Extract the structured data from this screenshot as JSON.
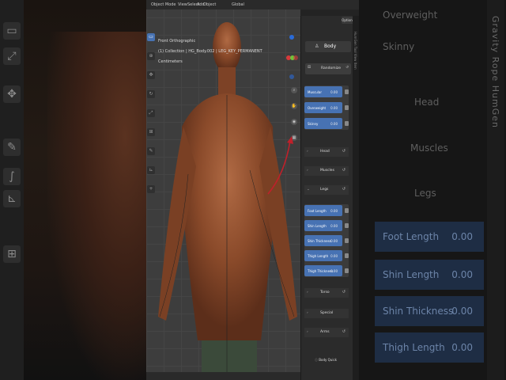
{
  "topbar": {
    "mode": "Object Mode",
    "menu": [
      "View",
      "Select",
      "Add",
      "Object"
    ],
    "transform": "Global",
    "options_label": "Options"
  },
  "viewport_info": {
    "view": "Front Orthographic",
    "collection": "(1) Collection | HG_Body.002 | LEG_KEY_PERMANENT",
    "units": "Centimeters"
  },
  "panel": {
    "title": "Body",
    "randomize_label": "Randomize",
    "top_sliders": [
      {
        "label": "Muscular",
        "value": "0.00"
      },
      {
        "label": "Overweight",
        "value": "0.00"
      },
      {
        "label": "Skinny",
        "value": "0.00"
      }
    ],
    "sections": [
      {
        "label": "Head",
        "expanded": false
      },
      {
        "label": "Muscles",
        "expanded": false
      },
      {
        "label": "Legs",
        "expanded": true
      }
    ],
    "leg_sliders": [
      {
        "label": "Foot Length",
        "value": "0.00"
      },
      {
        "label": "Shin Length",
        "value": "0.00"
      },
      {
        "label": "Shin Thickness",
        "value": "0.00"
      },
      {
        "label": "Thigh Length",
        "value": "0.00"
      },
      {
        "label": "Thigh Thickness",
        "value": "0.00"
      }
    ],
    "lower_sections": [
      {
        "label": "Torso",
        "expanded": false
      },
      {
        "label": "Special",
        "expanded": false
      },
      {
        "label": "Arms",
        "expanded": false
      }
    ],
    "footer": "Body Quick"
  },
  "side_tab_text": "HumGen  Tool  View  Item",
  "bg_right": {
    "tab_text": "Gravity Rope    HumGen",
    "top_rows": [
      {
        "label": "Overweight"
      },
      {
        "label": "Skinny"
      }
    ],
    "sections": [
      "Head",
      "Muscles",
      "Legs"
    ],
    "rows": [
      {
        "label": "Foot Length",
        "value": "0.00"
      },
      {
        "label": "Shin Length",
        "value": "0.00"
      },
      {
        "label": "Shin Thickness",
        "value": "0.00"
      },
      {
        "label": "Thigh Length",
        "value": "0.00"
      }
    ]
  },
  "colors": {
    "accent": "#4772b3",
    "panel_bg": "#2b2b2b",
    "viewport_bg": "#3d3d3d",
    "skin": "#8a4a2a"
  }
}
